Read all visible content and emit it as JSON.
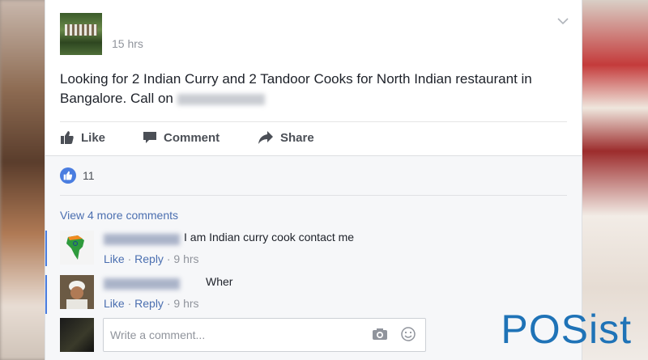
{
  "post": {
    "timestamp": "15 hrs",
    "text_main": "Looking for 2 Indian Curry and 2 Tandoor Cooks for North Indian restaurant in Bangalore. Call on",
    "menu_icon": "chevron-down-icon"
  },
  "actions": {
    "like": "Like",
    "comment": "Comment",
    "share": "Share"
  },
  "reactions": {
    "count": "11"
  },
  "comments": {
    "view_more": "View 4 more comments",
    "items": [
      {
        "text": "I am Indian curry cook contact me",
        "like": "Like",
        "reply": "Reply",
        "sep": "·",
        "time": "9 hrs"
      },
      {
        "text": "Wher",
        "like": "Like",
        "reply": "Reply",
        "sep": "·",
        "time": "9 hrs"
      }
    ]
  },
  "composer": {
    "placeholder": "Write a comment..."
  },
  "brand": {
    "logo": "POSist",
    "color": "#1f73b7"
  },
  "colors": {
    "link": "#4b6fb0",
    "accent": "#4a7de0",
    "muted": "#90949c"
  }
}
